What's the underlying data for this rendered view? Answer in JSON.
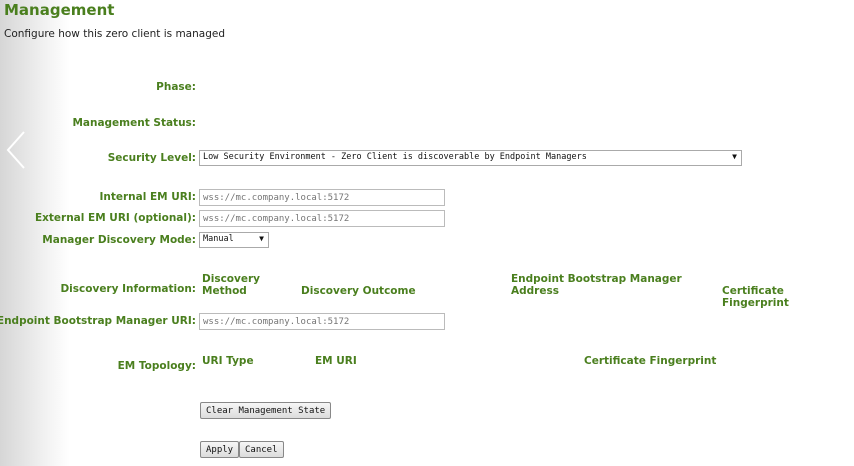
{
  "header": {
    "title": "Management",
    "subtitle": "Configure how this zero client is managed"
  },
  "labels": {
    "phase": "Phase:",
    "management_status": "Management Status:",
    "security_level": "Security Level:",
    "internal_em_uri": "Internal EM URI:",
    "external_em_uri": "External EM URI (optional):",
    "discovery_mode": "Manager Discovery Mode:",
    "discovery_info": "Discovery Information:",
    "ebm_uri": "Endpoint Bootstrap Manager URI:",
    "em_topology": "EM Topology:"
  },
  "security_level": {
    "selected": "Low Security Environment - Zero Client is discoverable by Endpoint Managers"
  },
  "internal_em_uri": {
    "value": "",
    "placeholder": "wss://mc.company.local:5172"
  },
  "external_em_uri": {
    "value": "",
    "placeholder": "wss://mc.company.local:5172"
  },
  "discovery_mode": {
    "selected": "Manual"
  },
  "discovery_columns": [
    "Discovery Method",
    "Discovery Outcome",
    "Endpoint Bootstrap Manager Address",
    "Certificate Fingerprint"
  ],
  "ebm_uri": {
    "value": "",
    "placeholder": "wss://mc.company.local:5172"
  },
  "topology_columns": [
    "URI Type",
    "EM URI",
    "Certificate Fingerprint"
  ],
  "buttons": {
    "clear": "Clear Management State",
    "apply": "Apply",
    "cancel": "Cancel"
  }
}
